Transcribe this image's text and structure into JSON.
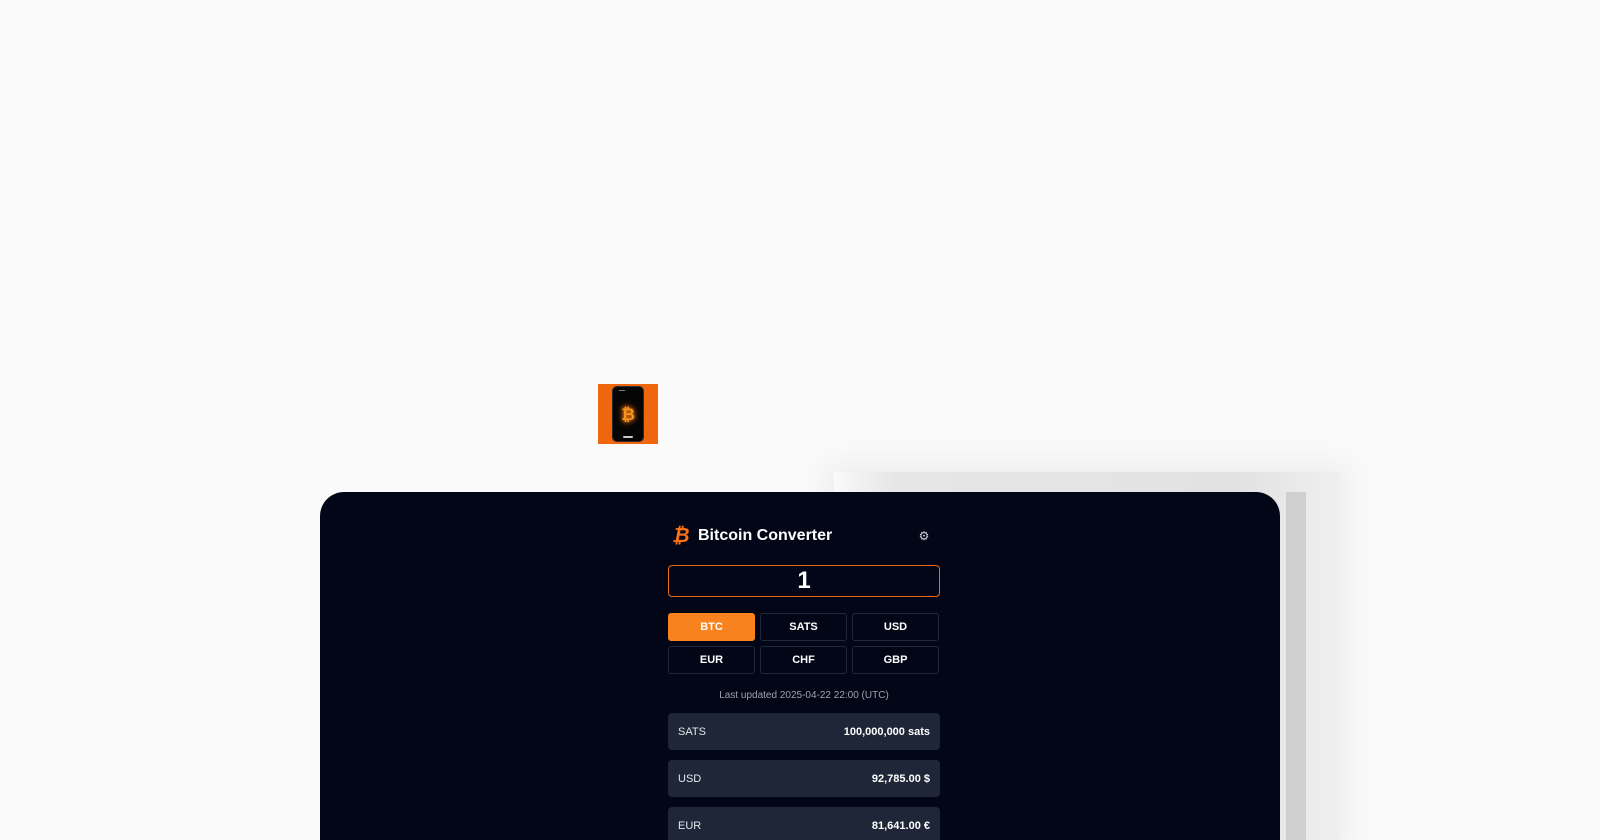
{
  "app_icon": {
    "name": "bitcoin-phone-icon",
    "glyph": "₿"
  },
  "header": {
    "logo_glyph": "₿",
    "title": "Bitcoin Converter",
    "settings_glyph": "⚙"
  },
  "input": {
    "value": "1"
  },
  "units": [
    {
      "label": "BTC",
      "active": true
    },
    {
      "label": "SATS",
      "active": false
    },
    {
      "label": "USD",
      "active": false
    },
    {
      "label": "EUR",
      "active": false
    },
    {
      "label": "CHF",
      "active": false
    },
    {
      "label": "GBP",
      "active": false
    }
  ],
  "last_updated": "Last updated 2025-04-22 22:00 (UTC)",
  "results": [
    {
      "label": "SATS",
      "value": "100,000,000 sats"
    },
    {
      "label": "USD",
      "value": "92,785.00 $"
    },
    {
      "label": "EUR",
      "value": "81,641.00 €"
    }
  ],
  "colors": {
    "accent": "#f7821e",
    "background": "#020617",
    "row": "#1e2637"
  }
}
